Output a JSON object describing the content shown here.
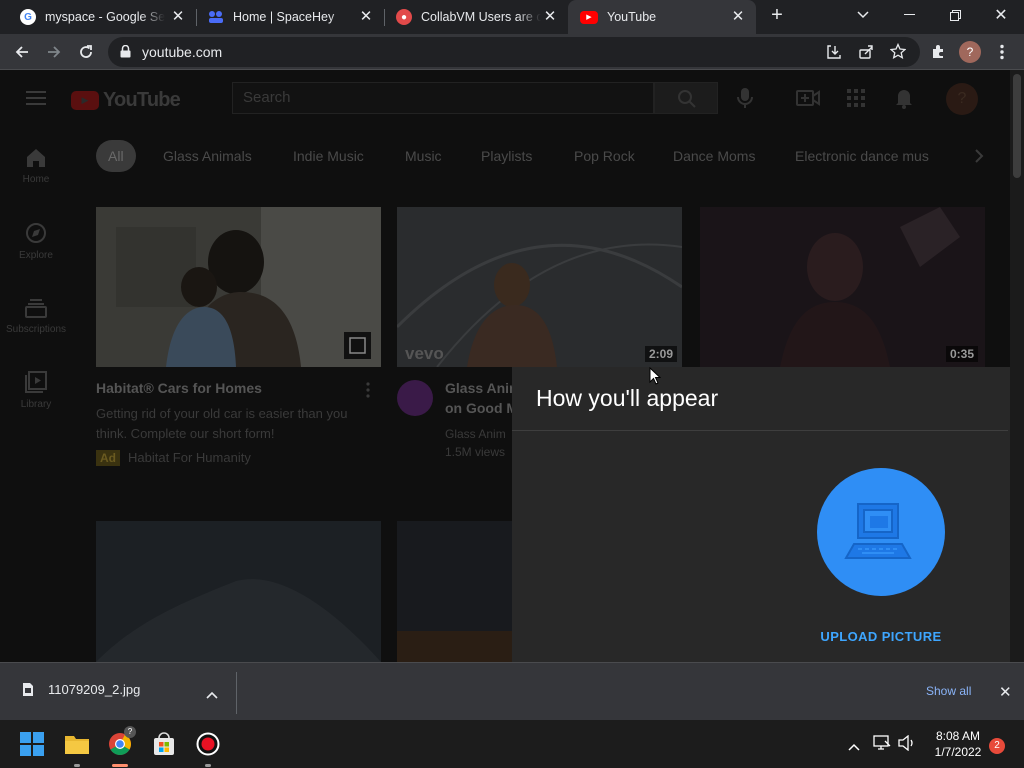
{
  "browser": {
    "tabs": [
      {
        "title": "myspace - Google Search",
        "favicon": "google-icon"
      },
      {
        "title": "Home | SpaceHey",
        "favicon": "spacehey-icon"
      },
      {
        "title": "CollabVM Users are creating",
        "favicon": "collabvm-icon"
      },
      {
        "title": "YouTube",
        "favicon": "youtube-icon",
        "active": true
      }
    ],
    "url": "youtube.com",
    "profile_letter": "?"
  },
  "youtube": {
    "logo_text": "YouTube",
    "search_placeholder": "Search",
    "avatar_letter": "?",
    "sidebar": [
      {
        "label": "Home",
        "icon": "home-icon"
      },
      {
        "label": "Explore",
        "icon": "compass-icon"
      },
      {
        "label": "Subscriptions",
        "icon": "subscriptions-icon"
      },
      {
        "label": "Library",
        "icon": "library-icon"
      }
    ],
    "chips": [
      "All",
      "Glass Animals",
      "Indie Music",
      "Music",
      "Playlists",
      "Pop Rock",
      "Dance Moms",
      "Electronic dance mus"
    ],
    "videos": [
      {
        "title": "Habitat® Cars for Homes",
        "desc1": "Getting rid of your old car is easier than you",
        "desc2": "think. Complete our short form!",
        "ad_badge": "Ad",
        "channel": "Habitat For Humanity"
      },
      {
        "title1": "Glass Anim",
        "title2": "on Good M",
        "channel": "Glass Anim",
        "views": "1.5M views",
        "duration": "2:09",
        "badge": "vevo"
      },
      {
        "duration": "0:35"
      }
    ]
  },
  "dialog": {
    "title": "How you'll appear",
    "upload_label": "UPLOAD PICTURE",
    "avatar_color": "#2f8ef5"
  },
  "downloads": {
    "filename": "11079209_2.jpg",
    "show_all": "Show all"
  },
  "taskbar": {
    "time": "8:08 AM",
    "date": "1/7/2022",
    "notifications": "2"
  }
}
